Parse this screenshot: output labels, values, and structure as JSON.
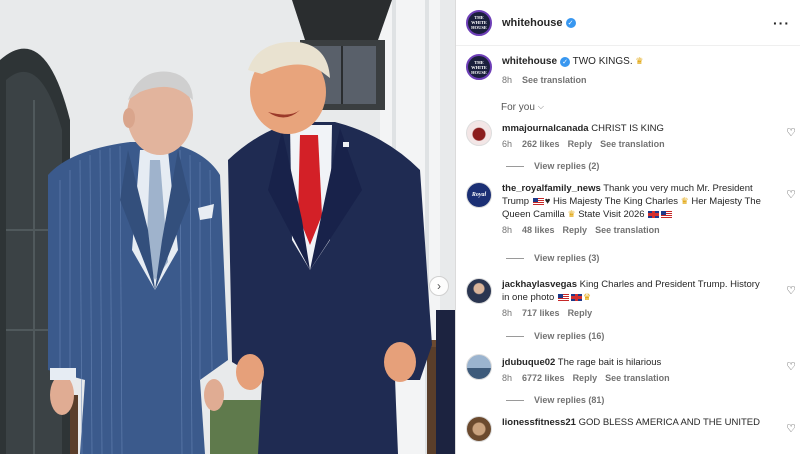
{
  "post": {
    "username": "whitehouse",
    "avatar_text": "THE WHITE HOUSE",
    "caption": "TWO KINGS.",
    "time": "8h",
    "see_translation": "See translation"
  },
  "filter": {
    "label": "For you"
  },
  "comments": [
    {
      "username": "mmajournalcanada",
      "text": "CHRIST IS KING",
      "time": "6h",
      "likes": "262 likes",
      "reply": "Reply",
      "translate": "See translation",
      "replies": "View replies (2)"
    },
    {
      "username": "the_royalfamily_news",
      "avatar_text": "Royal",
      "text_a": "Thank you very much Mr. President Trump",
      "text_b": "His Majesty The King Charles",
      "text_c": "Her Majesty The Queen Camilla",
      "text_d": "State Visit 2026",
      "time": "8h",
      "likes": "48 likes",
      "reply": "Reply",
      "translate": "See translation",
      "replies": "View replies (3)"
    },
    {
      "username": "jackhaylasvegas",
      "text_a": "King Charles and President Trump. History in one photo",
      "time": "8h",
      "likes": "717 likes",
      "reply": "Reply",
      "replies": "View replies (16)"
    },
    {
      "username": "jdubuque02",
      "text": "The rage bait is hilarious",
      "time": "8h",
      "likes": "6772 likes",
      "reply": "Reply",
      "translate": "See translation",
      "replies": "View replies (81)"
    },
    {
      "username": "lionessfitness21",
      "text": "GOD BLESS AMERICA AND THE UNITED"
    }
  ],
  "icons": {
    "verified": "verified-badge",
    "more": "more-options",
    "heart": "heart-outline",
    "next": "chevron-right",
    "crown": "crown-emoji"
  },
  "colors": {
    "verified_blue": "#3897f0",
    "muted_text": "#737373",
    "suit_navy": "#1f2b52",
    "pinstripe_blue": "#3b5a8c",
    "tie_red": "#d32027"
  }
}
